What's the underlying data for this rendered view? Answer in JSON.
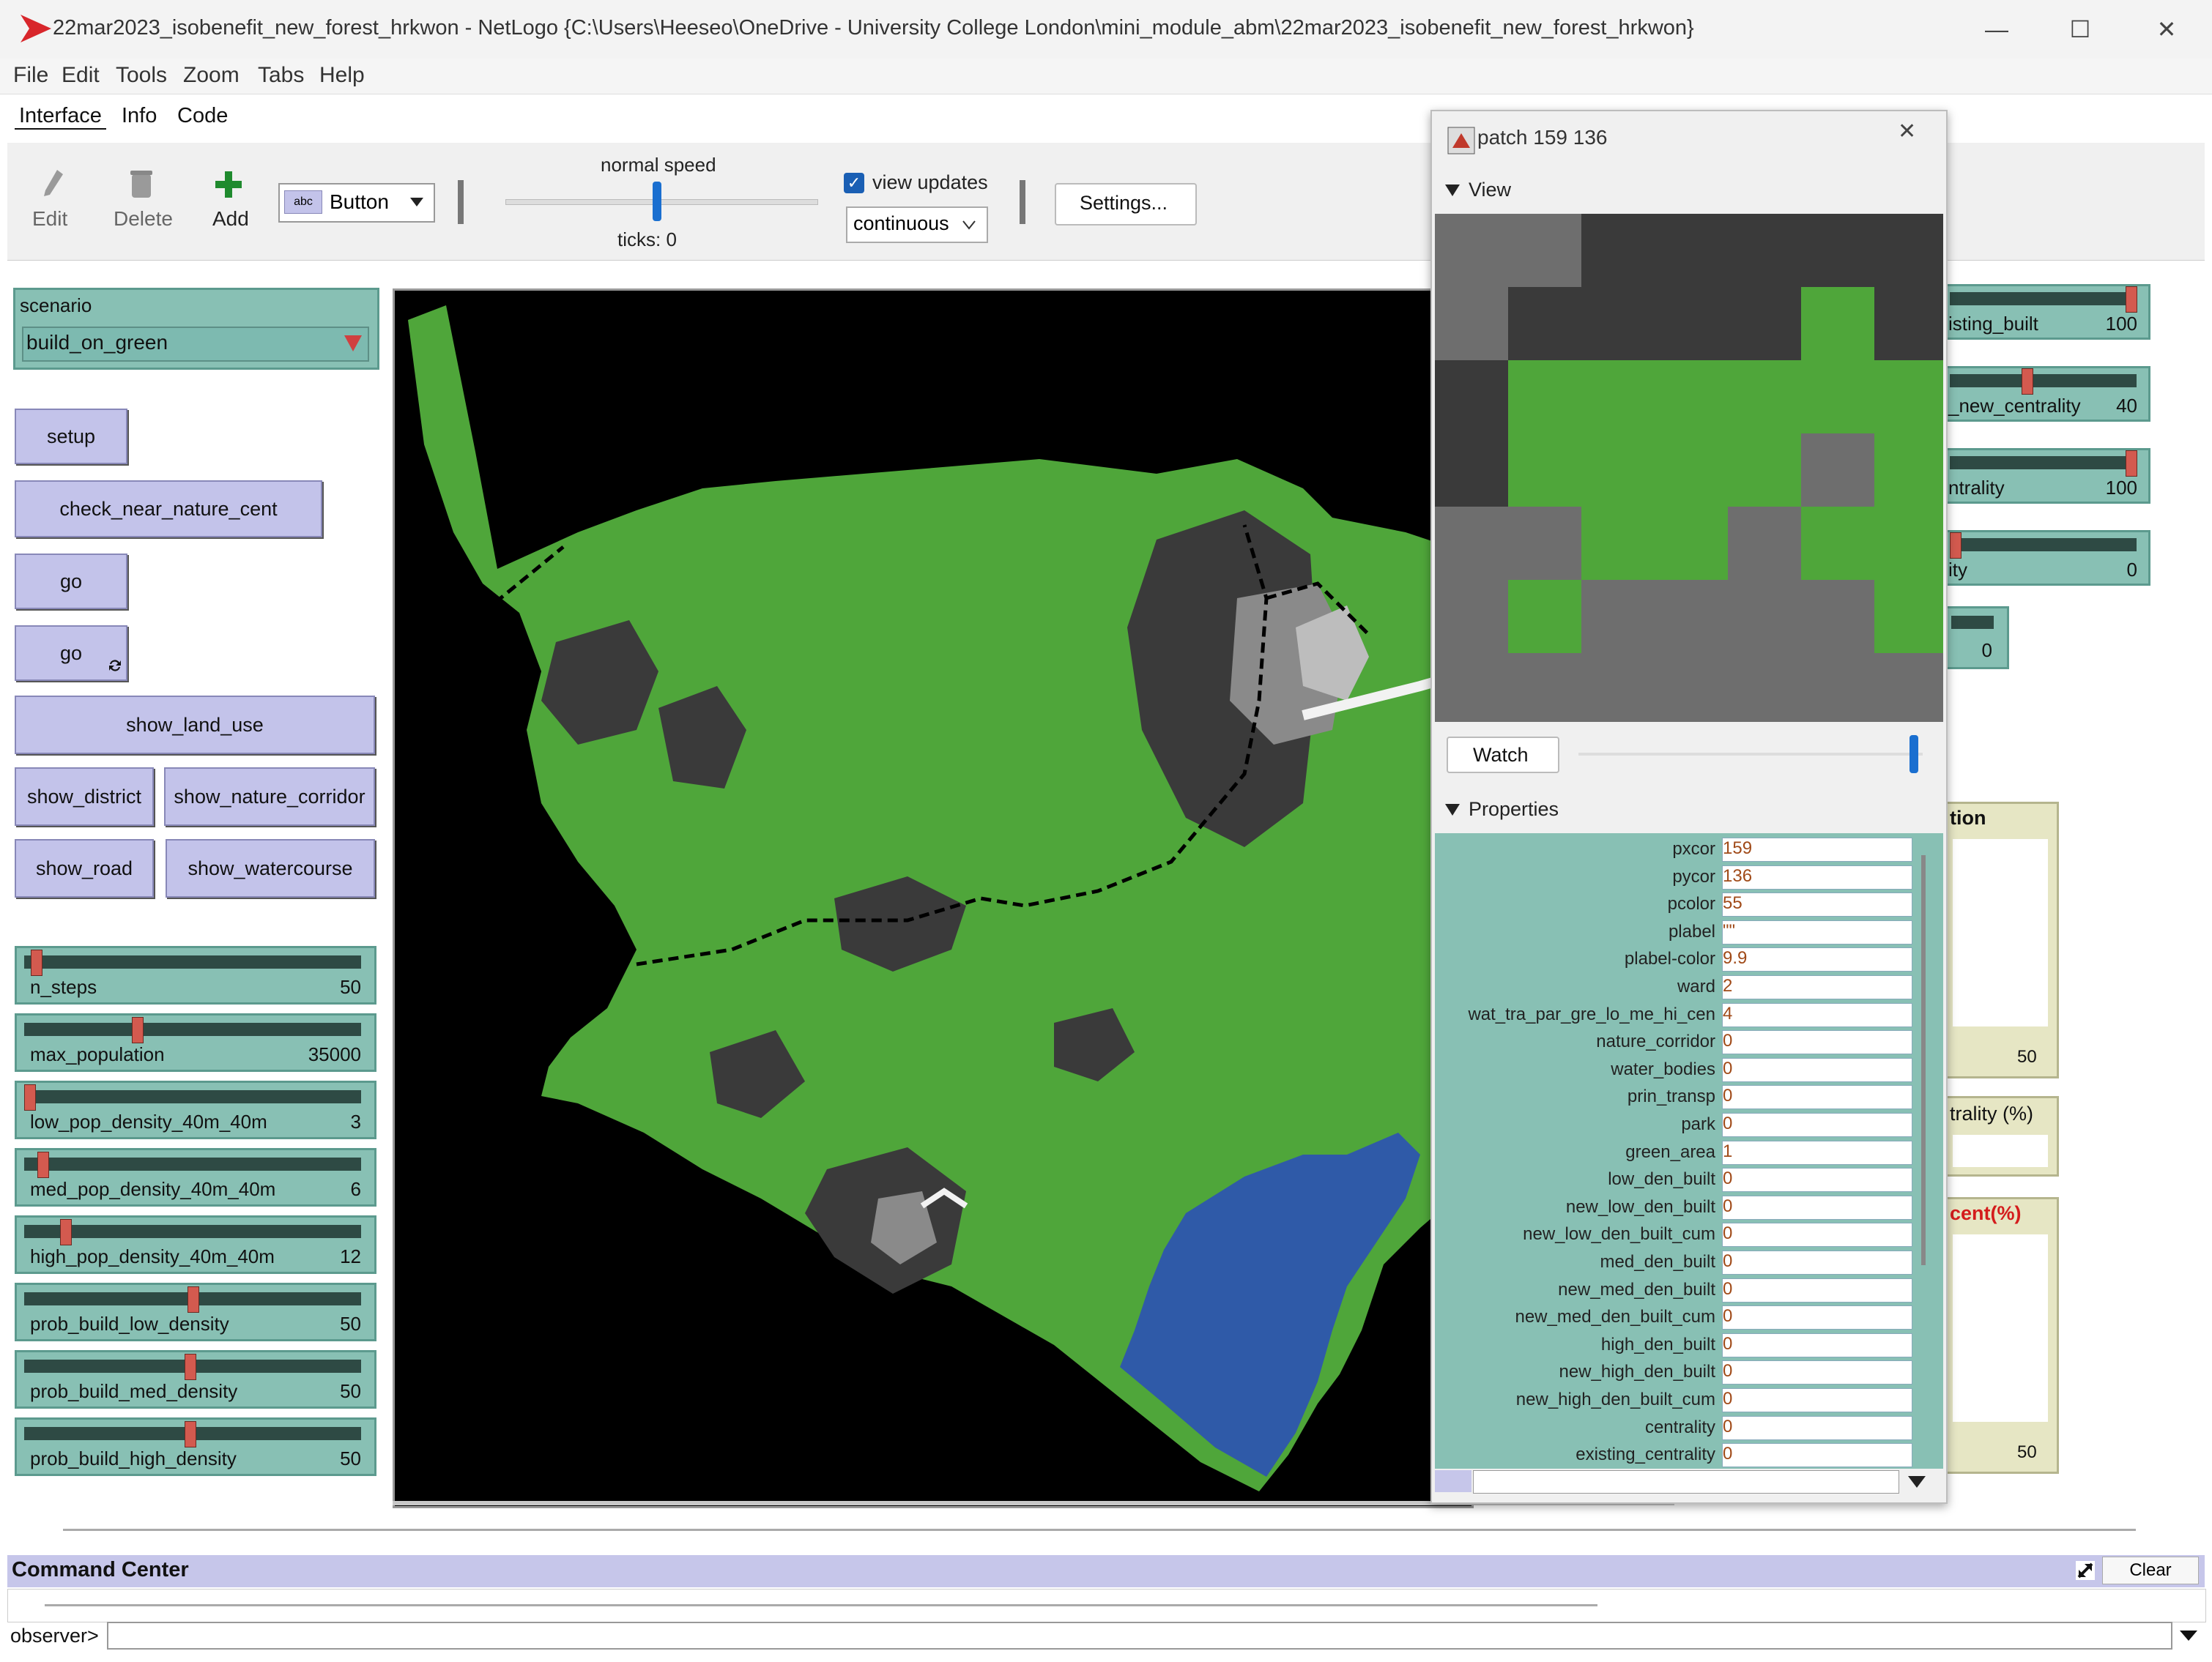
{
  "window": {
    "title": "22mar2023_isobenefit_new_forest_hrkwon - NetLogo {C:\\Users\\Heeseo\\OneDrive - University College London\\mini_module_abm\\22mar2023_isobenefit_new_forest_hrkwon}",
    "minimize": "—",
    "maximize": "☐",
    "close": "✕"
  },
  "menu": [
    "File",
    "Edit",
    "Tools",
    "Zoom",
    "Tabs",
    "Help"
  ],
  "tabs": [
    "Interface",
    "Info",
    "Code"
  ],
  "toolbar": {
    "edit": "Edit",
    "delete": "Delete",
    "add": "Add",
    "widget_type": "Button",
    "widget_type_badge": "abc",
    "speed_label": "normal speed",
    "ticks": "ticks: 0",
    "view_updates": "view updates",
    "update_mode": "continuous",
    "settings": "Settings..."
  },
  "chooser": {
    "label": "scenario",
    "value": "build_on_green"
  },
  "buttons": {
    "setup": "setup",
    "check": "check_near_nature_cent",
    "go": "go",
    "go_forever": "go",
    "show_land_use": "show_land_use",
    "show_district": "show_district",
    "show_nature_corridor": "show_nature_corridor",
    "show_road": "show_road",
    "show_watercourse": "show_watercourse"
  },
  "sliders": [
    {
      "name": "n_steps",
      "value": "50",
      "pos": 0.02
    },
    {
      "name": "max_population",
      "value": "35000",
      "pos": 0.33
    },
    {
      "name": "low_pop_density_40m_40m",
      "value": "3",
      "pos": 0.0
    },
    {
      "name": "med_pop_density_40m_40m",
      "value": "6",
      "pos": 0.04
    },
    {
      "name": "high_pop_density_40m_40m",
      "value": "12",
      "pos": 0.11
    },
    {
      "name": "prob_build_low_density",
      "value": "50",
      "pos": 0.5
    },
    {
      "name": "prob_build_med_density",
      "value": "50",
      "pos": 0.49
    },
    {
      "name": "prob_build_high_density",
      "value": "50",
      "pos": 0.49
    }
  ],
  "inspector": {
    "title": "patch 159 136",
    "view_section": "View",
    "watch": "Watch",
    "properties_section": "Properties",
    "properties": [
      {
        "name": "pxcor",
        "value": "159"
      },
      {
        "name": "pycor",
        "value": "136"
      },
      {
        "name": "pcolor",
        "value": "55"
      },
      {
        "name": "plabel",
        "value": "\"\""
      },
      {
        "name": "plabel-color",
        "value": "9.9"
      },
      {
        "name": "ward",
        "value": "2"
      },
      {
        "name": "wat_tra_par_gre_lo_me_hi_cen",
        "value": "4"
      },
      {
        "name": "nature_corridor",
        "value": "0"
      },
      {
        "name": "water_bodies",
        "value": "0"
      },
      {
        "name": "prin_transp",
        "value": "0"
      },
      {
        "name": "park",
        "value": "0"
      },
      {
        "name": "green_area",
        "value": "1"
      },
      {
        "name": "low_den_built",
        "value": "0"
      },
      {
        "name": "new_low_den_built",
        "value": "0"
      },
      {
        "name": "new_low_den_built_cum",
        "value": "0"
      },
      {
        "name": "med_den_built",
        "value": "0"
      },
      {
        "name": "new_med_den_built",
        "value": "0"
      },
      {
        "name": "new_med_den_built_cum",
        "value": "0"
      },
      {
        "name": "high_den_built",
        "value": "0"
      },
      {
        "name": "new_high_den_built",
        "value": "0"
      },
      {
        "name": "new_high_den_built_cum",
        "value": "0"
      },
      {
        "name": "centrality",
        "value": "0"
      },
      {
        "name": "existing_centrality",
        "value": "0"
      }
    ]
  },
  "right_widgets": [
    {
      "label": "isting_built",
      "value": "100",
      "pos": 0.98
    },
    {
      "label": "_new_centrality",
      "value": "40",
      "pos": 0.4
    },
    {
      "label": "ntrality",
      "value": "100",
      "pos": 0.98
    },
    {
      "label": "ity",
      "value": "0",
      "pos": 0.0
    }
  ],
  "right_small_value": "0",
  "plots": {
    "p1_title": "tion",
    "p1_value": "50",
    "monitor_label": "trality (%)",
    "p2_title": "cent(%)",
    "p2_value": "50"
  },
  "colors": {
    "green": "#4fa63a",
    "water": "#2f5aa8",
    "dark": "#3a3a3a",
    "panel": "#88c0b4",
    "button": "#c3c3ea"
  },
  "command_center": {
    "title": "Command Center",
    "clear": "Clear",
    "prompt": "observer>"
  }
}
